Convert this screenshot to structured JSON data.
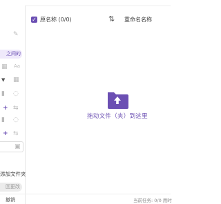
{
  "header": {
    "original_name_col": "原名称 (0/0)",
    "new_name_col": "重命名名称"
  },
  "left_panel": {
    "chip_label": "之间的",
    "aa_label": "Aa",
    "add_folder_label": "添加文件夹",
    "revert_label": "回更改"
  },
  "drop_zone": {
    "label": "拖动文件（夹）到这里",
    "icon": "folder-upload-icon",
    "accent": "#6b4fb3"
  },
  "status": {
    "undo_label": "撤销",
    "task_text": "当前任务: 0/0  用时"
  }
}
